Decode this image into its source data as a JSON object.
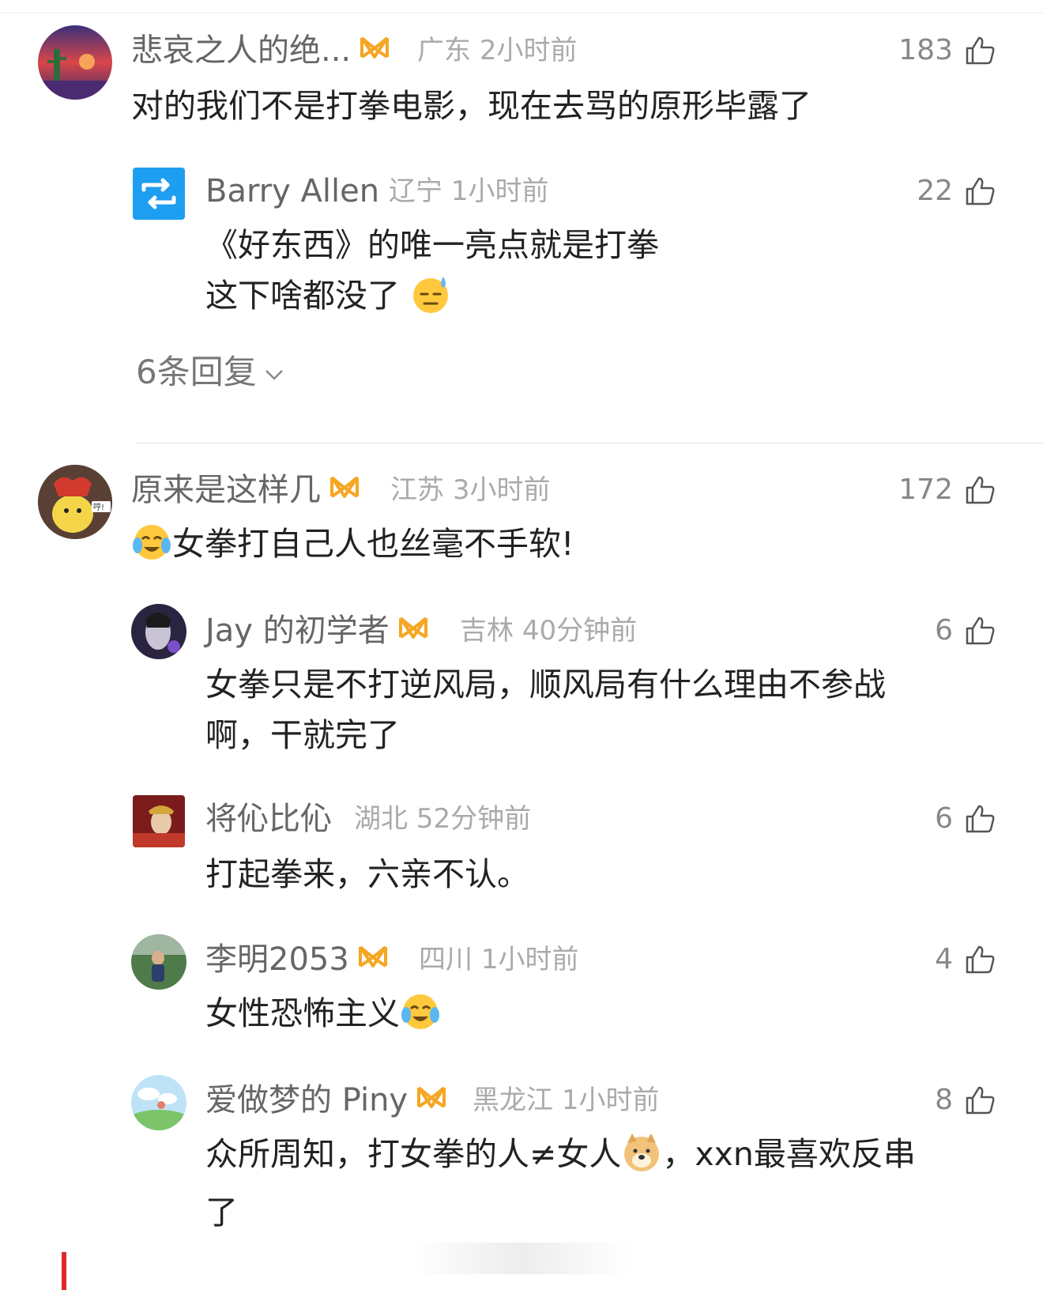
{
  "colors": {
    "vip": "#f5a623",
    "repost": "#1e9ef0",
    "text": "#222222",
    "meta": "#aaaaaa"
  },
  "comments": [
    {
      "name": "悲哀之人的绝...",
      "location": "广东",
      "time": "2小时前",
      "likes": "183",
      "lines": [
        "对的我们不是打拳电影，现在去骂的原形毕露了"
      ],
      "vip": true
    },
    {
      "name": "Barry Allen",
      "location": "辽宁",
      "time": "1小时前",
      "likes": "22",
      "lines": [
        "《好东西》的唯一亮点就是打拳",
        "这下啥都没了"
      ],
      "icon": "repost-icon"
    },
    {
      "name": "原来是这样几",
      "location": "江苏",
      "time": "3小时前",
      "likes": "172",
      "lines": [
        "女拳打自己人也丝毫不手软!"
      ],
      "vip": true
    },
    {
      "name": "Jay 的初学者",
      "location": "吉林",
      "time": "40分钟前",
      "likes": "6",
      "lines": [
        "女拳只是不打逆风局，顺风局有什么理由不参战",
        "啊，干就完了"
      ],
      "vip": true
    },
    {
      "name": "将伈比伈",
      "location": "湖北",
      "time": "52分钟前",
      "likes": "6",
      "lines": [
        "打起拳来，六亲不认。"
      ]
    },
    {
      "name": "李明2053",
      "location": "四川",
      "time": "1小时前",
      "likes": "4",
      "lines": [
        "女性恐怖主义"
      ],
      "vip": true
    },
    {
      "name": "爱做梦的 Piny",
      "location": "黑龙江",
      "time": "1小时前",
      "likes": "8",
      "lines": [
        "众所周知，打女拳的人≠女人",
        "，xxn最喜欢反串",
        "了"
      ],
      "vip": true
    }
  ],
  "replies_label": "6条回复"
}
